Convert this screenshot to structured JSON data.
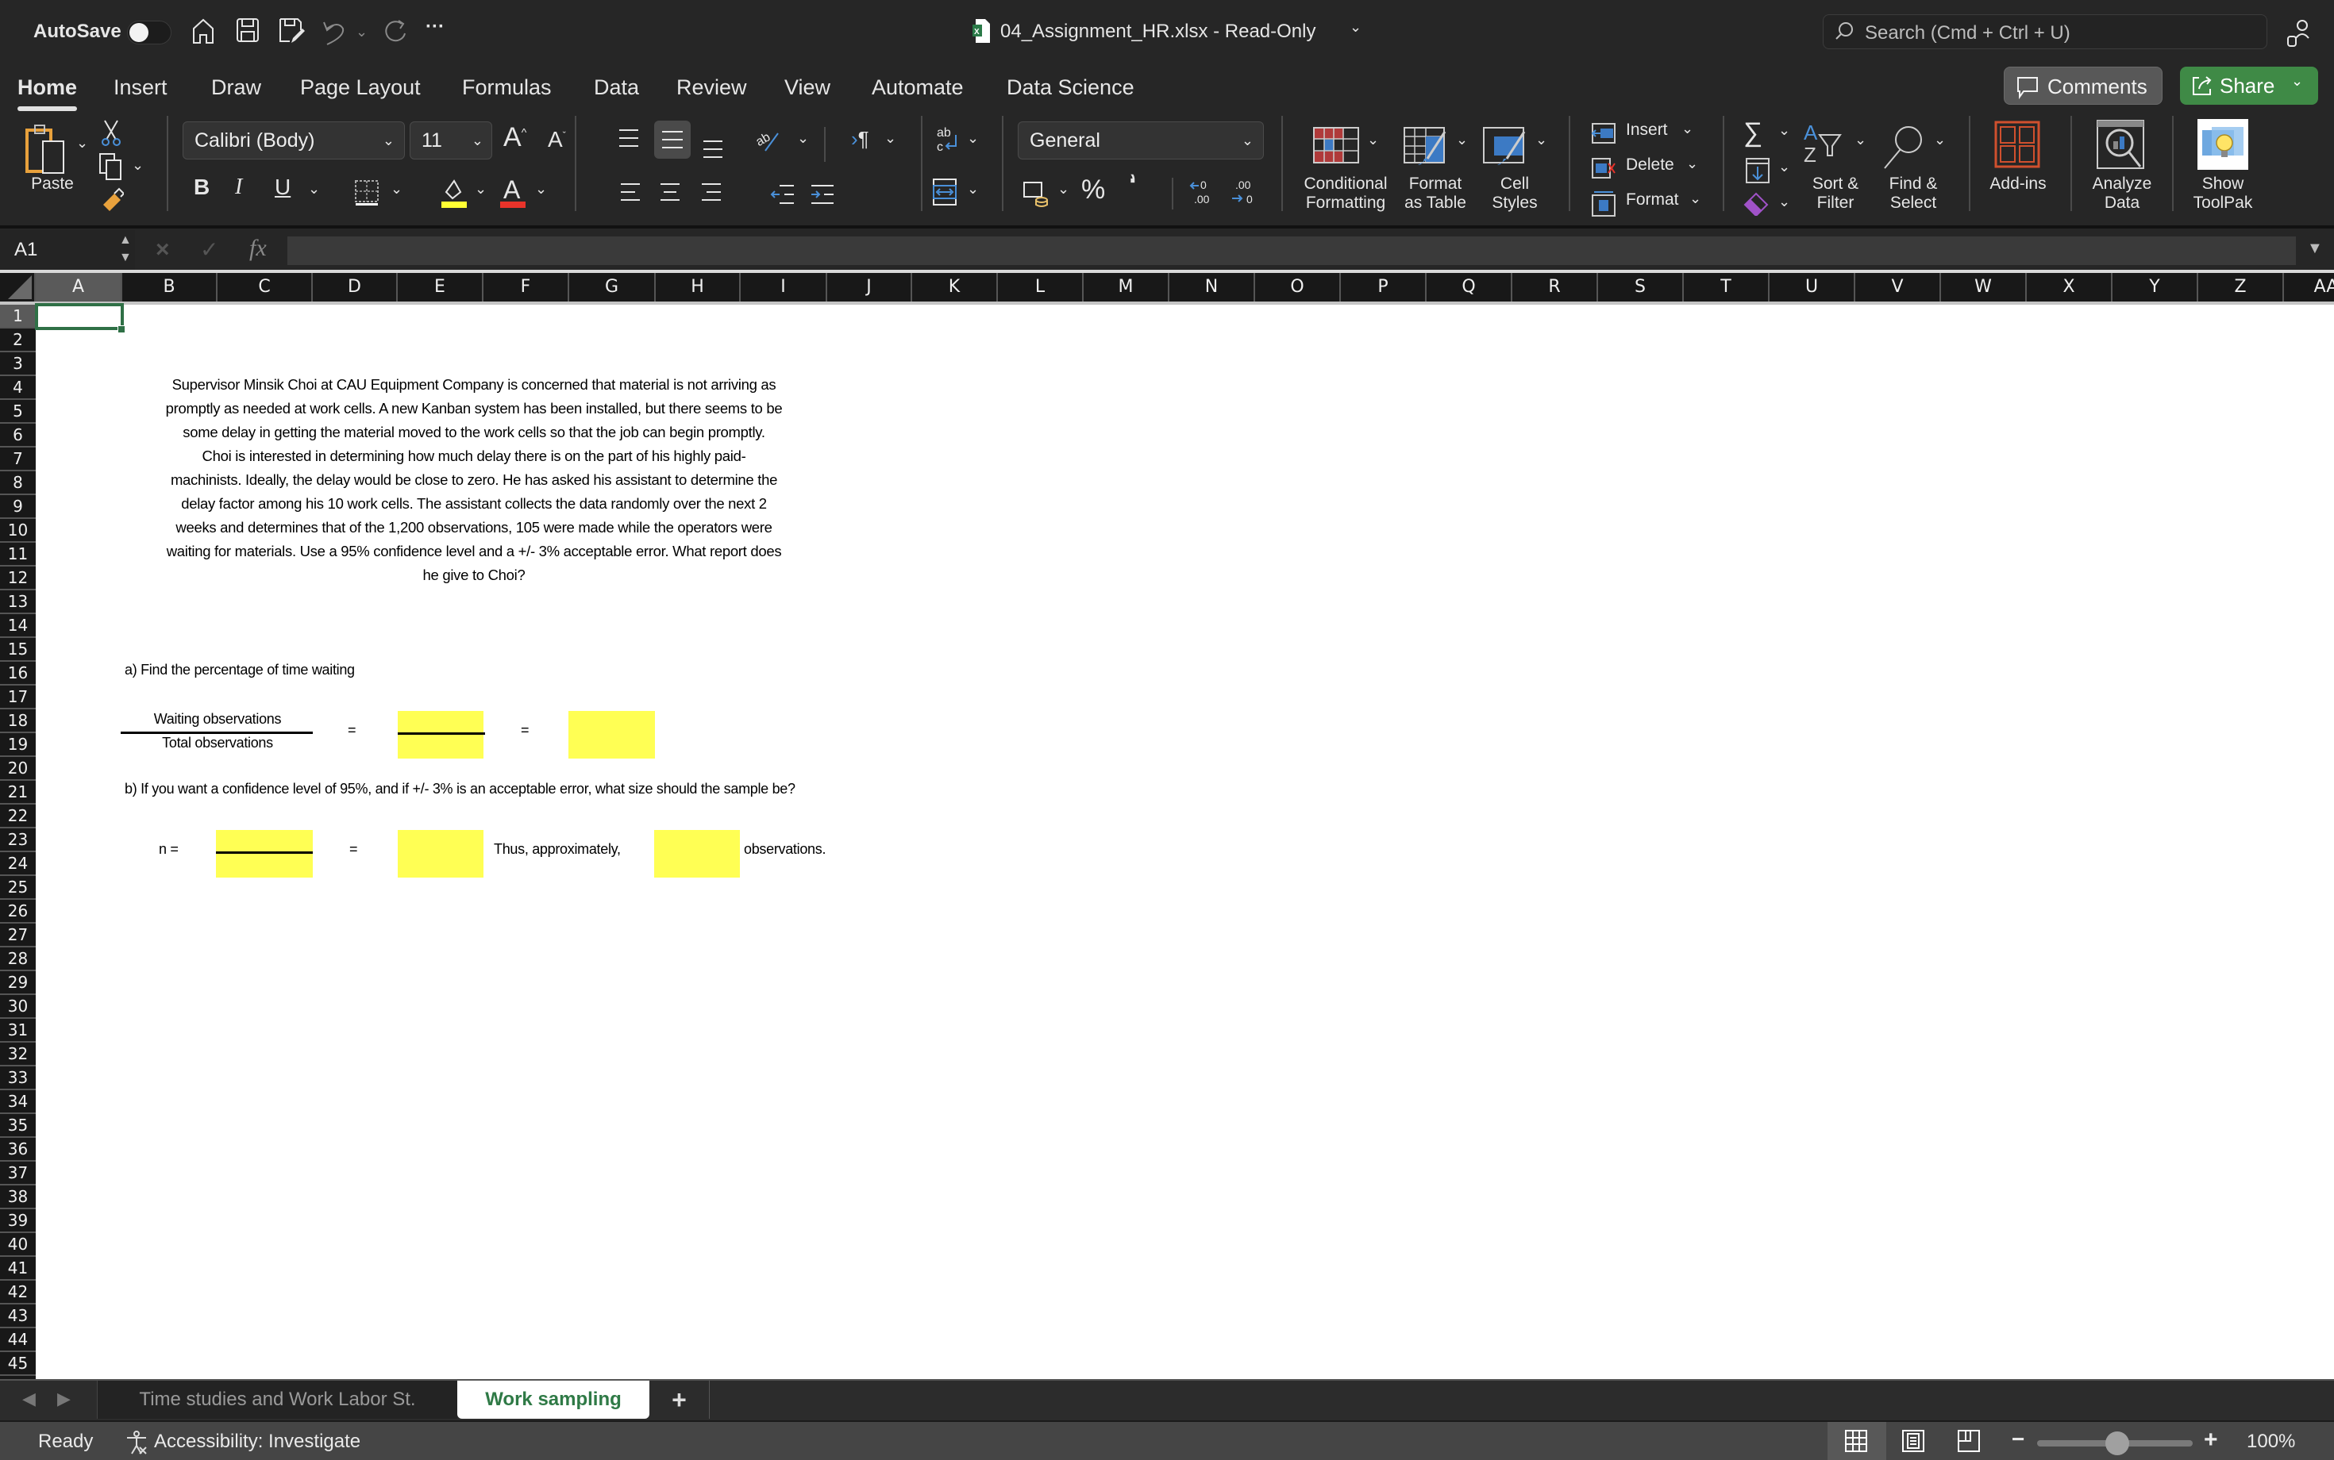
{
  "titlebar": {
    "autosave_label": "AutoSave",
    "autosave_on": false,
    "document_title": "04_Assignment_HR.xlsx  -  Read-Only",
    "search_placeholder": "Search (Cmd + Ctrl + U)",
    "more_label": "···"
  },
  "tabs": [
    {
      "label": "Home",
      "active": true
    },
    {
      "label": "Insert"
    },
    {
      "label": "Draw"
    },
    {
      "label": "Page Layout"
    },
    {
      "label": "Formulas"
    },
    {
      "label": "Data"
    },
    {
      "label": "Review"
    },
    {
      "label": "View"
    },
    {
      "label": "Automate"
    },
    {
      "label": "Data Science"
    }
  ],
  "header_buttons": {
    "comments": "Comments",
    "share": "Share"
  },
  "ribbon": {
    "paste": "Paste",
    "font_name": "Calibri (Body)",
    "font_size": "11",
    "bold": "B",
    "italic": "I",
    "underline": "U",
    "number_format": "General",
    "percent": "%",
    "comma": "9",
    "conditional_formatting": [
      "Conditional",
      "Formatting"
    ],
    "format_as_table": [
      "Format",
      "as Table"
    ],
    "cell_styles": [
      "Cell",
      "Styles"
    ],
    "insert": "Insert",
    "delete": "Delete",
    "format": "Format",
    "sort_filter": [
      "Sort &",
      "Filter"
    ],
    "find_select": [
      "Find &",
      "Select"
    ],
    "addins": "Add-ins",
    "analyze_data": [
      "Analyze",
      "Data"
    ],
    "show_toolpak": [
      "Show",
      "ToolPak"
    ],
    "colors": {
      "highlight": "#ffff33",
      "font_color": "#e8332a"
    }
  },
  "formula_bar": {
    "name_box": "A1",
    "formula": "",
    "fx": "fx"
  },
  "columns": [
    "A",
    "B",
    "C",
    "D",
    "E",
    "F",
    "G",
    "H",
    "I",
    "J",
    "K",
    "L",
    "M",
    "N",
    "O",
    "P",
    "Q",
    "R",
    "S",
    "T",
    "U",
    "V",
    "W",
    "X",
    "Y",
    "Z",
    "AA"
  ],
  "selected_cell": "A1",
  "sheet": {
    "problem_lines": [
      "Supervisor Minsik Choi at CAU Equipment Company is concerned that material is not arriving as",
      "promptly as needed at work cells. A new Kanban system has been installed, but there seems to be",
      "some delay in getting the material moved to the work cells so that the job can begin promptly.",
      "Choi is interested in determining how much delay there is on the part of his highly paid-",
      "machinists. Ideally, the delay would be close to zero. He has asked his assistant to determine the",
      "delay factor among his 10 work cells. The assistant collects the data randomly over the next 2",
      "weeks and determines that of the 1,200 observations, 105 were made while the operators were",
      "waiting for materials. Use a 95% confidence level and a +/- 3% acceptable error. What report does",
      "he give to Choi?"
    ],
    "part_a": "a) Find the percentage of time waiting",
    "numerator": "Waiting observations",
    "denominator": "Total observations",
    "equals": "=",
    "part_b": "b) If you want a confidence level of 95%, and if +/- 3% is an acceptable error, what size should the sample be?",
    "n_label": "n =",
    "thus": "Thus, approximately,",
    "observations": "observations.",
    "answer_fill": "#ffff54"
  },
  "sheet_tabs": [
    {
      "label": "Time studies and Work Labor St.",
      "active": false
    },
    {
      "label": "Work sampling",
      "active": true
    }
  ],
  "add_sheet": "+",
  "status": {
    "ready": "Ready",
    "accessibility": "Accessibility: Investigate",
    "zoom": "100%",
    "zoom_minus": "−",
    "zoom_plus": "+"
  }
}
